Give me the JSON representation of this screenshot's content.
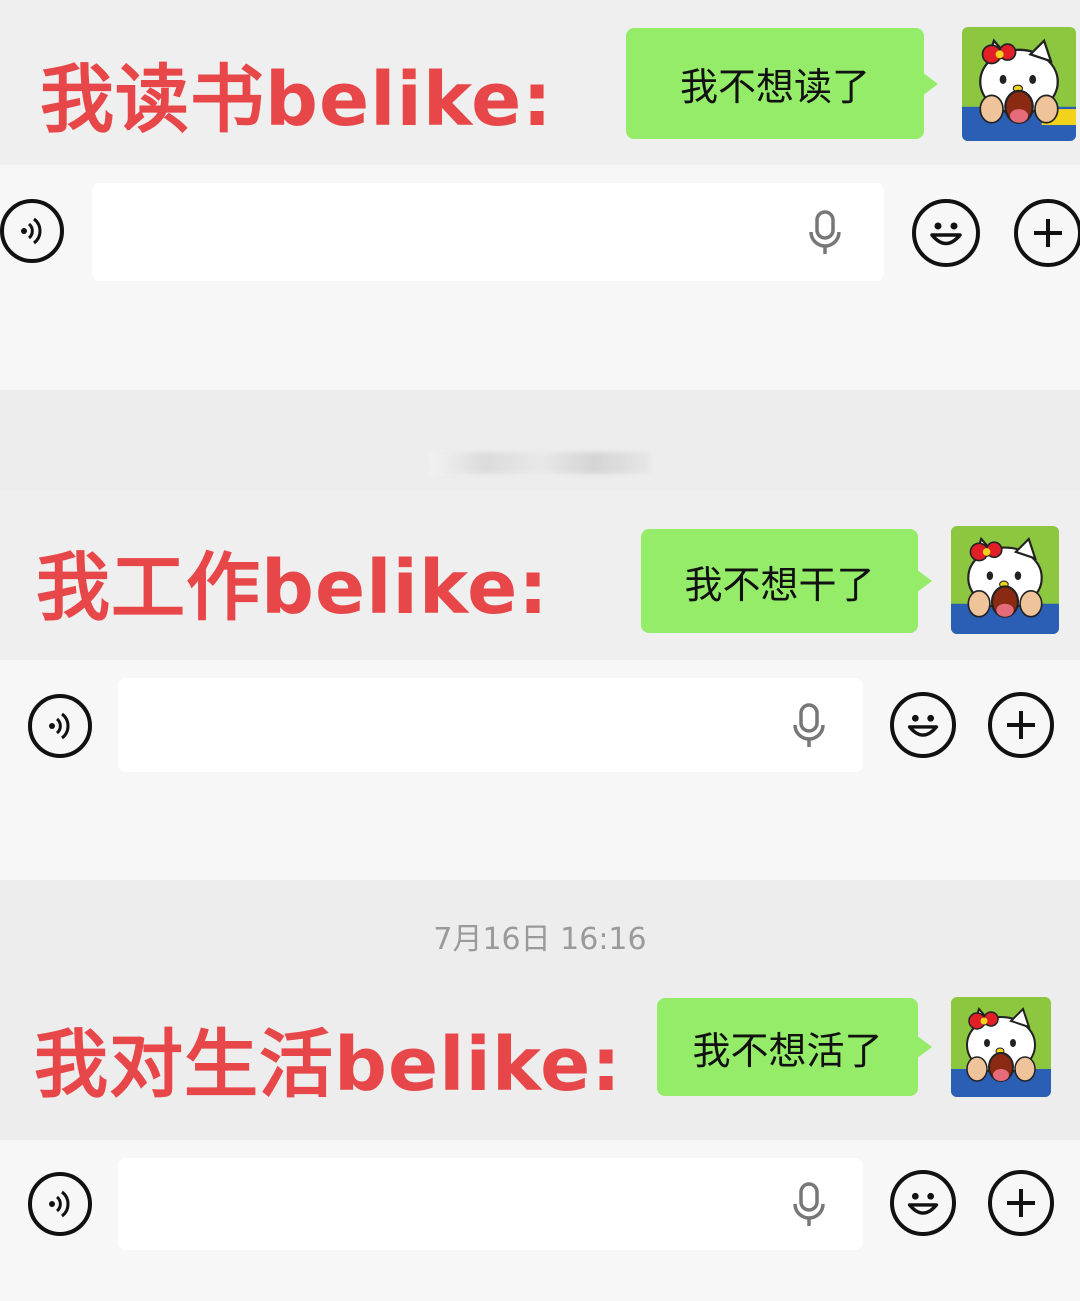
{
  "colors": {
    "caption": "#e8474a",
    "bubble": "#95ec69",
    "background": "#ededed"
  },
  "panels": [
    {
      "caption": "我读书belike:",
      "message": "我不想读了"
    },
    {
      "caption": "我工作belike:",
      "message": "我不想干了"
    },
    {
      "caption": "我对生活belike:",
      "message": "我不想活了"
    }
  ],
  "timestamp": "7月16日 16:16",
  "icons": {
    "voice": "voice-icon",
    "mic": "microphone-icon",
    "emoji": "emoji-icon",
    "plus": "plus-icon",
    "avatar": "hello-kitty-avatar"
  }
}
